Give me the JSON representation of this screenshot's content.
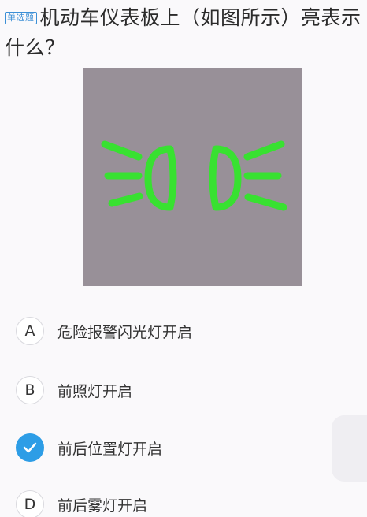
{
  "question": {
    "tag": "单选题",
    "text": "机动车仪表板上（如图所示）亮表示什么？"
  },
  "figure": {
    "icon": "front-position-lamp-icon",
    "background_color": "#989098",
    "icon_color": "#33e62c"
  },
  "options": [
    {
      "letter": "A",
      "text": "危险报警闪光灯开启",
      "selected": false
    },
    {
      "letter": "B",
      "text": "前照灯开启",
      "selected": false
    },
    {
      "letter": "C",
      "text": "前后位置灯开启",
      "selected": true
    },
    {
      "letter": "D",
      "text": "前后雾灯开启",
      "selected": false
    }
  ],
  "colors": {
    "accent": "#2d9de6",
    "tag": "#3b8fd6"
  }
}
